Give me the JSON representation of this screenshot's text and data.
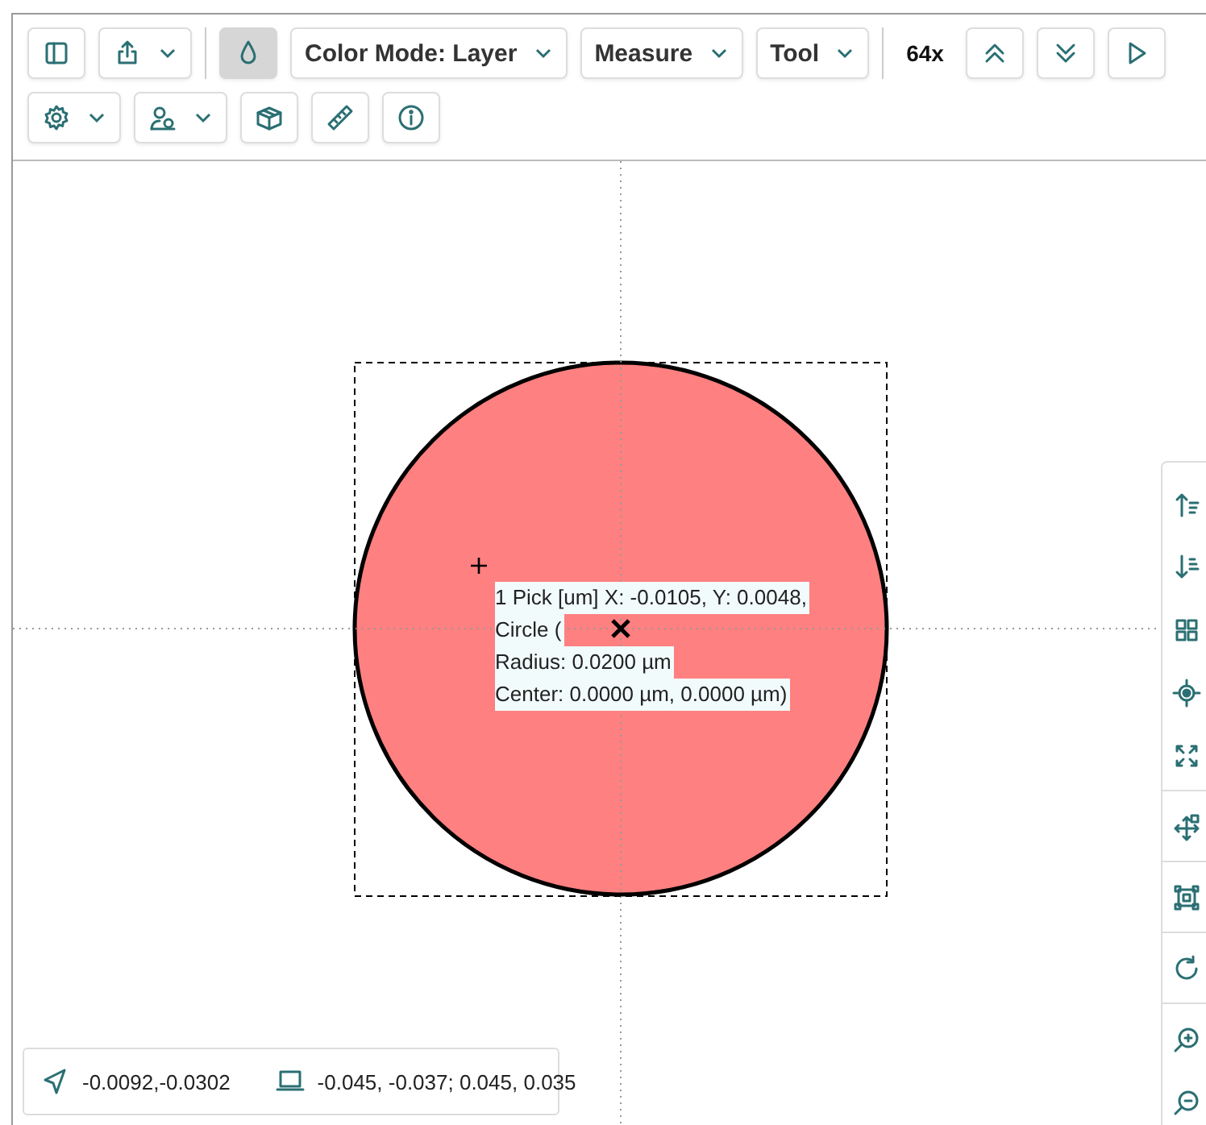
{
  "toolbar": {
    "rows": [
      [
        {
          "kind": "icon"
        },
        {
          "kind": "menu"
        },
        {
          "kind": "divider"
        },
        {
          "kind": "toggle",
          "selected": true
        },
        {
          "kind": "dropdown",
          "label": "Color Mode: Layer"
        },
        {
          "kind": "dropdown",
          "label": "Measure"
        },
        {
          "kind": "dropdown",
          "label": "Tool"
        },
        {
          "kind": "divider"
        },
        {
          "kind": "zoom",
          "label": "64x"
        },
        {
          "kind": "icon"
        },
        {
          "kind": "icon"
        },
        {
          "kind": "icon"
        }
      ],
      [
        {
          "kind": "menu"
        },
        {
          "kind": "menu"
        },
        {
          "kind": "icon"
        },
        {
          "kind": "icon"
        },
        {
          "kind": "icon"
        }
      ]
    ]
  },
  "canvas": {
    "shape": {
      "kind": "circle",
      "selected": true
    },
    "measurement_label": [
      "1 Pick [um] X: -0.0105, Y: 0.0048,",
      "Circle (",
      "Radius: 0.0200 µm",
      "Center: 0.0000 µm, 0.0000 µm)"
    ]
  },
  "side_tools": [
    {
      "kind": "tool"
    },
    {
      "kind": "tool"
    },
    {
      "kind": "tool"
    },
    {
      "kind": "tool"
    },
    {
      "kind": "tool"
    },
    {
      "kind": "divider"
    },
    {
      "kind": "tool"
    },
    {
      "kind": "divider"
    },
    {
      "kind": "tool"
    },
    {
      "kind": "divider"
    },
    {
      "kind": "tool"
    },
    {
      "kind": "divider"
    },
    {
      "kind": "tool"
    },
    {
      "kind": "tool"
    }
  ],
  "status_bar": {
    "cursor": "-0.0092,-0.0302",
    "extent": "-0.045, -0.037; 0.045, 0.035"
  }
}
